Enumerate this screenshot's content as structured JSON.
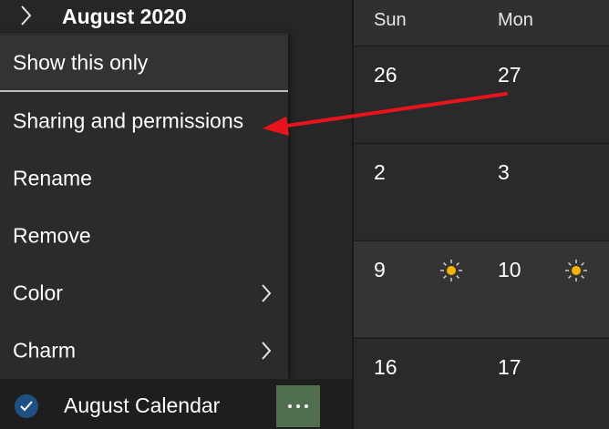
{
  "header": {
    "month_title": "August 2020",
    "chevron_icon": "chevron-right-icon"
  },
  "context_menu": {
    "items": [
      {
        "label": "Show this only",
        "has_submenu": false
      },
      {
        "label": "Sharing and permissions",
        "has_submenu": false
      },
      {
        "label": "Rename",
        "has_submenu": false
      },
      {
        "label": "Remove",
        "has_submenu": false
      },
      {
        "label": "Color",
        "has_submenu": true
      },
      {
        "label": "Charm",
        "has_submenu": true
      }
    ]
  },
  "calendar_row": {
    "name": "August Calendar",
    "checked": true,
    "check_icon": "checkmark-icon",
    "more_icon": "more-horizontal-icon"
  },
  "calendar_grid": {
    "days_of_week": [
      "Sun",
      "Mon"
    ],
    "weeks": [
      {
        "days": [
          "26",
          "27"
        ],
        "weather": false
      },
      {
        "days": [
          "2",
          "3"
        ],
        "weather": false
      },
      {
        "days": [
          "9",
          "10"
        ],
        "weather": true,
        "weather_icon": "sun-icon"
      },
      {
        "days": [
          "16",
          "17"
        ],
        "weather": false
      }
    ]
  },
  "annotation": {
    "type": "arrow",
    "color": "#e8141b",
    "points_to": "Sharing and permissions"
  },
  "colors": {
    "background": "#1f1f1f",
    "menu_background": "#2b2b2b",
    "check_circle": "#1f4f85",
    "more_button": "#4f6f4f",
    "sun_yellow": "#f4b400"
  }
}
